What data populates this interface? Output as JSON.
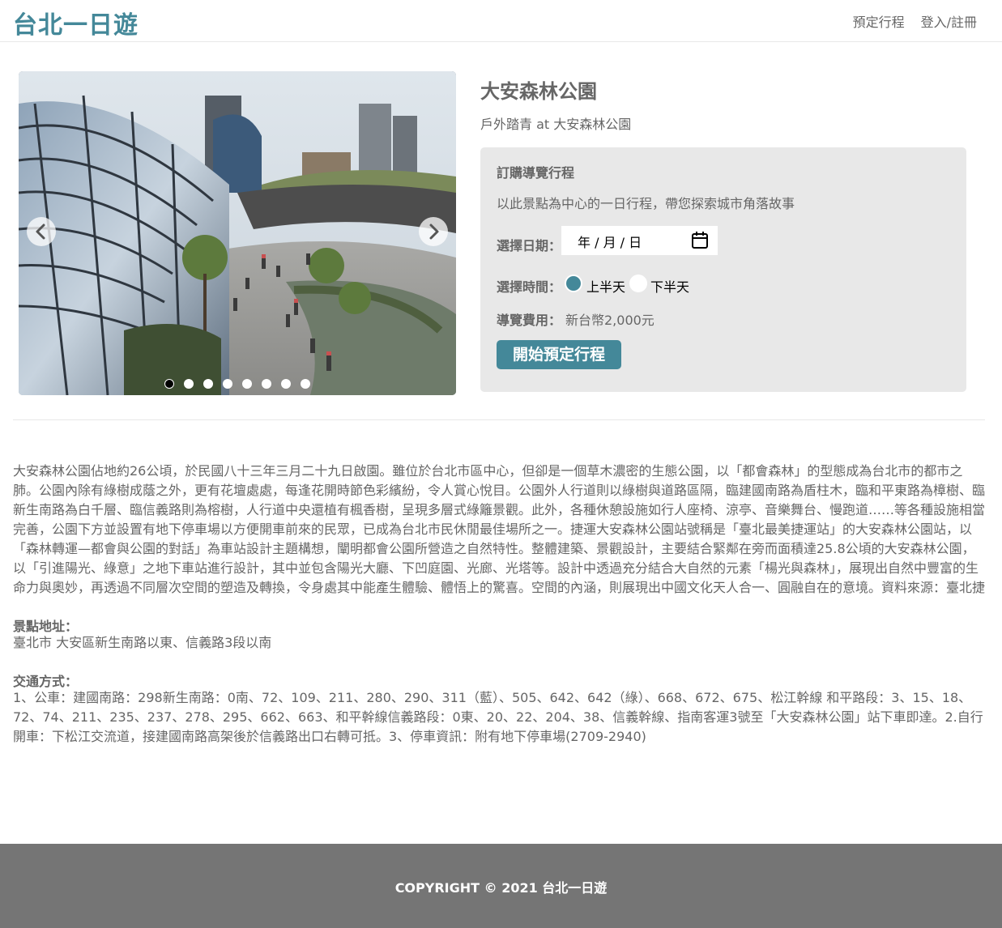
{
  "header": {
    "logo": "台北一日遊",
    "nav": [
      "預定行程",
      "登入/註冊"
    ]
  },
  "carousel": {
    "dot_count": 8,
    "active_index": 0
  },
  "attraction": {
    "name": "大安森林公園",
    "subtitle": "戶外踏青 at 大安森林公園"
  },
  "booking": {
    "title": "訂購導覽行程",
    "description": "以此景點為中心的一日行程，帶您探索城市角落故事",
    "date_label": "選擇日期：",
    "date_placeholder": "年 / 月 / 日",
    "time_label": "選擇時間：",
    "time_options": [
      "上半天",
      "下半天"
    ],
    "time_selected": 0,
    "fee_label": "導覽費用：",
    "fee_value": "新台幣2,000元",
    "start_button": "開始預定行程"
  },
  "description": "大安森林公園佔地約26公頃，於民國八十三年三月二十九日啟園。雖位於台北市區中心，但卻是一個草木濃密的生態公園，以「都會森林」的型態成為台北市的都市之肺。公園內除有綠樹成蔭之外，更有花壇處處，每逢花開時節色彩繽紛，令人賞心悅目。公園外人行道則以綠樹與道路區隔，臨建國南路為盾柱木，臨和平東路為樟樹、臨新生南路為白千層、臨信義路則為榕樹，人行道中央還植有楓香樹，呈現多層式綠籬景觀。此外，各種休憩設施如行人座椅、涼亭、音樂舞台、慢跑道……等各種設施相當完善，公園下方並設置有地下停車場以方便開車前來的民眾，已成為台北市民休閒最佳場所之一。捷運大安森林公園站號稱是「臺北最美捷運站」的大安森林公園站，以「森林轉運—都會與公園的對話」為車站設計主題構想，闡明都會公園所營造之自然特性。整體建築、景觀設計，主要結合緊鄰在旁而面積達25.8公頃的大安森林公園，以「引進陽光、綠意」之地下車站進行設計，其中並包含陽光大廳、下凹庭園、光廊、光塔等。設計中透過充分結合大自然的元素「楊光與森林」，展現出自然中豐富的生命力與奧妙，再透過不同層次空間的塑造及轉換，令身處其中能產生體驗、體悟上的驚喜。空間的內涵，則展現出中國文化天人合一、圓融自在的意境。資料來源：臺北捷運",
  "address": {
    "label": "景點地址：",
    "value": "臺北市 大安區新生南路以東、信義路3段以南"
  },
  "transport": {
    "label": "交通方式：",
    "value": "1、公車：建國南路：298新生南路：0南、72、109、211、280、290、311（藍）、505、642、642（綠）、668、672、675、松江幹線 和平路段：3、15、18、72、74、211、235、237、278、295、662、663、和平幹線信義路段：0東、20、22、204、38、信義幹線、指南客運3號至「大安森林公園」站下車即達。2.自行開車：下松江交流道，接建國南路高架後於信義路出口右轉可抵。3、停車資訊：附有地下停車場(2709-2940)"
  },
  "footer": {
    "copyright": "COPYRIGHT © 2021 台北一日遊"
  },
  "colors": {
    "accent": "#448899",
    "text": "#666666",
    "panel": "#e8e8e8",
    "footer": "#757575"
  }
}
